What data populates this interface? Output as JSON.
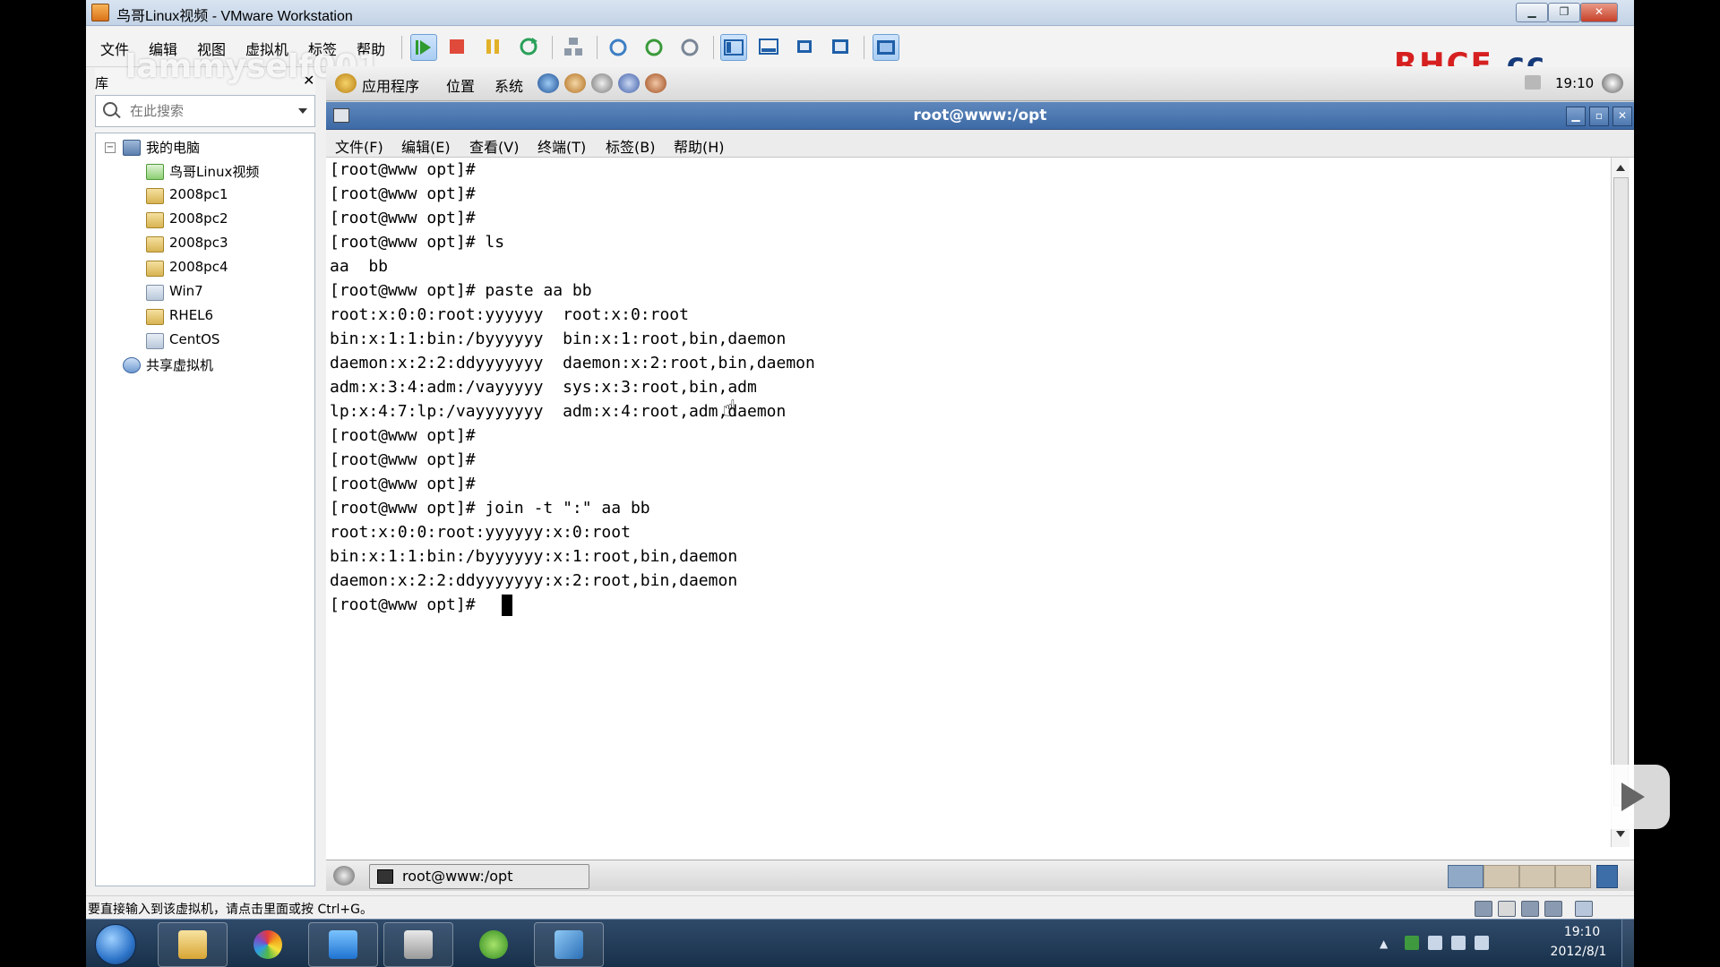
{
  "vmware": {
    "title": "鸟哥Linux视频 - VMware Workstation",
    "menus": [
      "文件",
      "编辑",
      "视图",
      "虚拟机",
      "标签",
      "帮助"
    ],
    "logo_main": "RHCE",
    "logo_suffix": ".cc",
    "status_text": "要直接输入到该虚拟机，请点击里面或按 Ctrl+G。"
  },
  "library": {
    "header": "库",
    "close": "✕",
    "search_placeholder": "在此搜索",
    "watermark": "lammyself001",
    "tree": {
      "root": "我的电脑",
      "items": [
        "鸟哥Linux视频",
        "2008pc1",
        "2008pc2",
        "2008pc3",
        "2008pc4",
        "Win7",
        "RHEL6",
        "CentOS"
      ],
      "shared": "共享虚拟机"
    }
  },
  "guest_panel": {
    "applications": "应用程序",
    "places": "位置",
    "system": "系统",
    "clock": "19:10"
  },
  "terminal": {
    "title": "root@www:/opt",
    "menus": [
      "文件(F)",
      "编辑(E)",
      "查看(V)",
      "终端(T)",
      "标签(B)",
      "帮助(H)"
    ],
    "lines": [
      "[root@www opt]#",
      "[root@www opt]#",
      "[root@www opt]#",
      "[root@www opt]# ls",
      "aa  bb",
      "[root@www opt]# paste aa bb",
      "root:x:0:0:root:yyyyyy  root:x:0:root",
      "bin:x:1:1:bin:/byyyyyy  bin:x:1:root,bin,daemon",
      "daemon:x:2:2:ddyyyyyyy  daemon:x:2:root,bin,daemon",
      "adm:x:3:4:adm:/vayyyyy  sys:x:3:root,bin,adm",
      "lp:x:4:7:lp:/vayyyyyyy  adm:x:4:root,adm,daemon",
      "[root@www opt]#",
      "[root@www opt]#",
      "[root@www opt]#",
      "[root@www opt]# join -t \":\" aa bb",
      "root:x:0:0:root:yyyyyy:x:0:root",
      "bin:x:1:1:bin:/byyyyyy:x:1:root,bin,daemon",
      "daemon:x:2:2:ddyyyyyyy:x:2:root,bin,daemon",
      "[root@www opt]# "
    ]
  },
  "guest_taskbar": {
    "task_label": "root@www:/opt"
  },
  "windows_taskbar": {
    "time": "19:10",
    "date": "2012/8/1"
  },
  "colors": {
    "rhce_red": "#d62020",
    "terminal_title": "#3d6aa6"
  }
}
